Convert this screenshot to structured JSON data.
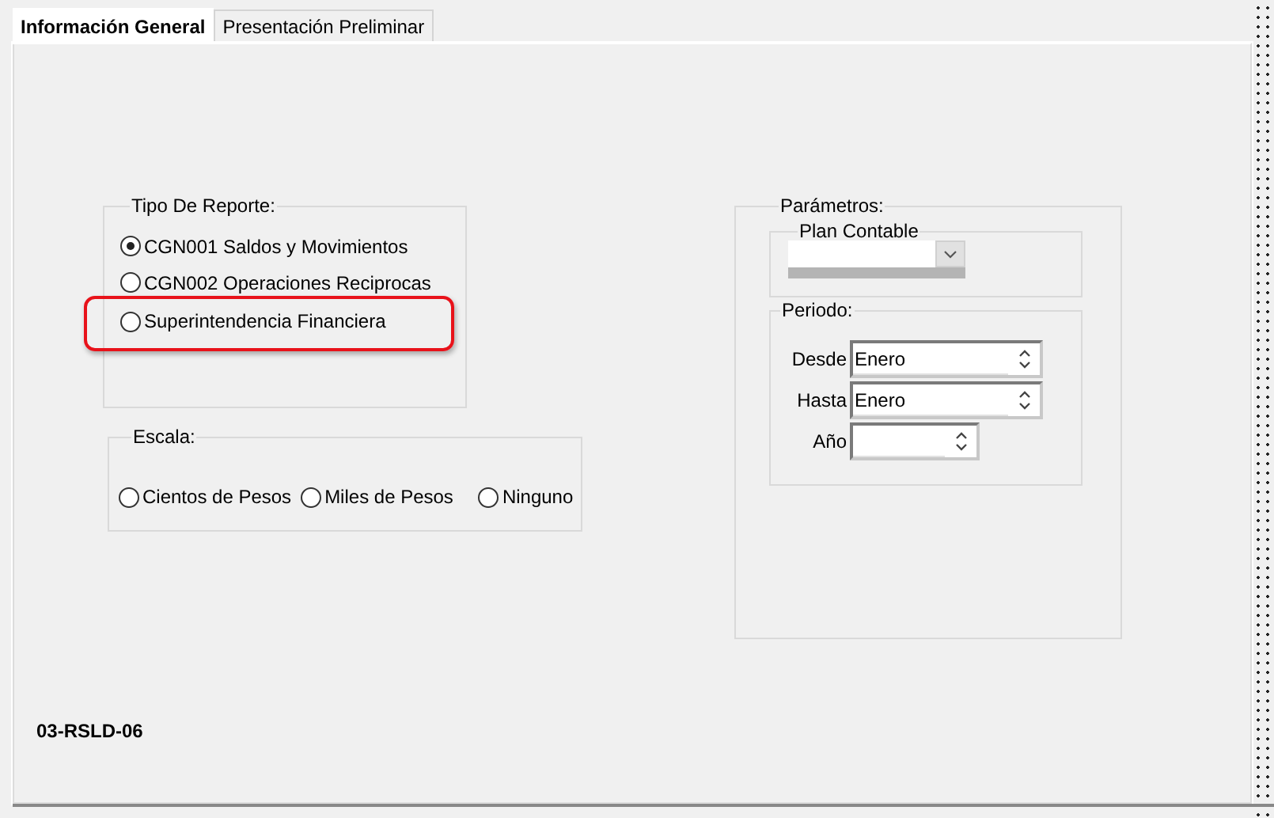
{
  "tabs": [
    {
      "label": "Información General",
      "selected": true
    },
    {
      "label": "Presentación Preliminar",
      "selected": false
    }
  ],
  "tipo_de_reporte": {
    "title": "Tipo De Reporte:",
    "options": [
      {
        "label": "CGN001 Saldos y Movimientos",
        "selected": true,
        "highlighted": false
      },
      {
        "label": "CGN002 Operaciones Reciprocas",
        "selected": false,
        "highlighted": false
      },
      {
        "label": "Superintendencia Financiera",
        "selected": false,
        "highlighted": true
      }
    ]
  },
  "escala": {
    "title": "Escala:",
    "options": [
      {
        "label": "Cientos de Pesos",
        "selected": false
      },
      {
        "label": "Miles de Pesos",
        "selected": false
      },
      {
        "label": "Ninguno",
        "selected": false
      }
    ]
  },
  "parametros": {
    "title": "Parámetros:",
    "plan_contable": {
      "title": "Plan Contable"
    },
    "periodo": {
      "title": "Periodo:",
      "fields": [
        {
          "label": "Desde",
          "value": "Enero"
        },
        {
          "label": "Hasta",
          "value": "Enero"
        },
        {
          "label": "Año"
        }
      ]
    }
  },
  "report_code": "03-RSLD-06"
}
